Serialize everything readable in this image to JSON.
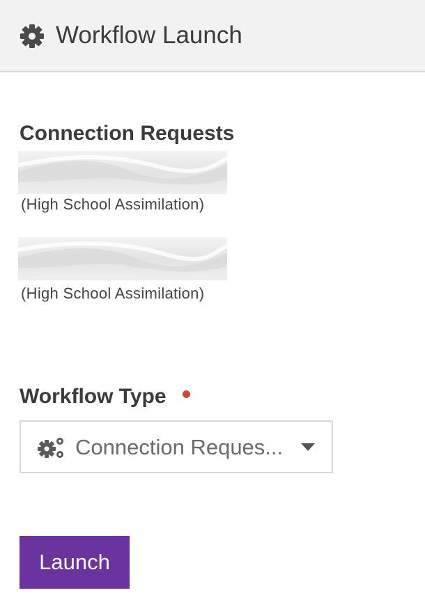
{
  "header": {
    "title": "Workflow Launch",
    "icon": "gear-icon"
  },
  "connection_requests": {
    "heading": "Connection Requests",
    "items": [
      {
        "campus": "(High School Assimilation)"
      },
      {
        "campus": "(High School Assimilation)"
      }
    ]
  },
  "workflow_type": {
    "label": "Workflow Type",
    "required": true,
    "required_color": "#c9483b",
    "selected_value": "Connection Reques...",
    "icon": "cogs-icon"
  },
  "launch": {
    "label": "Launch",
    "color": "#6b33a0"
  }
}
